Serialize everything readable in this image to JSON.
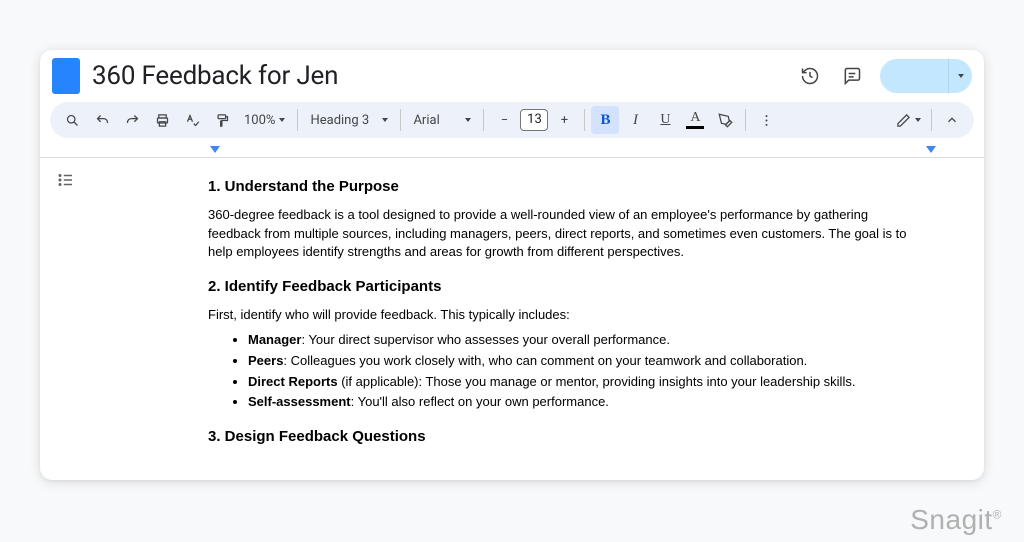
{
  "doc": {
    "title": "360 Feedback for Jen"
  },
  "toolbar": {
    "zoom": "100%",
    "style": "Heading 3",
    "font": "Arial",
    "font_size": "13",
    "bold_label": "B",
    "italic_label": "I",
    "underline_label": "U",
    "text_color_letter": "A",
    "minus": "−",
    "plus": "+"
  },
  "content": {
    "h1": "1. Understand the Purpose",
    "p1": "360-degree feedback is a tool designed to provide a well-rounded view of an employee's performance by gathering feedback from multiple sources, including managers, peers, direct reports, and sometimes even customers. The goal is to help employees identify strengths and areas for growth from different perspectives.",
    "h2": "2. Identify Feedback Participants",
    "p2": "First, identify who will provide feedback. This typically includes:",
    "bullets": [
      {
        "label": "Manager",
        "text": ": Your direct supervisor who assesses your overall performance."
      },
      {
        "label": "Peers",
        "text": ": Colleagues you work closely with, who can comment on your teamwork and collaboration."
      },
      {
        "label": "Direct Reports",
        "text": " (if applicable): Those you manage or mentor, providing insights into your leadership skills."
      },
      {
        "label": "Self-assessment",
        "text": ": You'll also reflect on your own performance."
      }
    ],
    "h3": "3. Design Feedback Questions"
  },
  "watermark": "Snagit"
}
